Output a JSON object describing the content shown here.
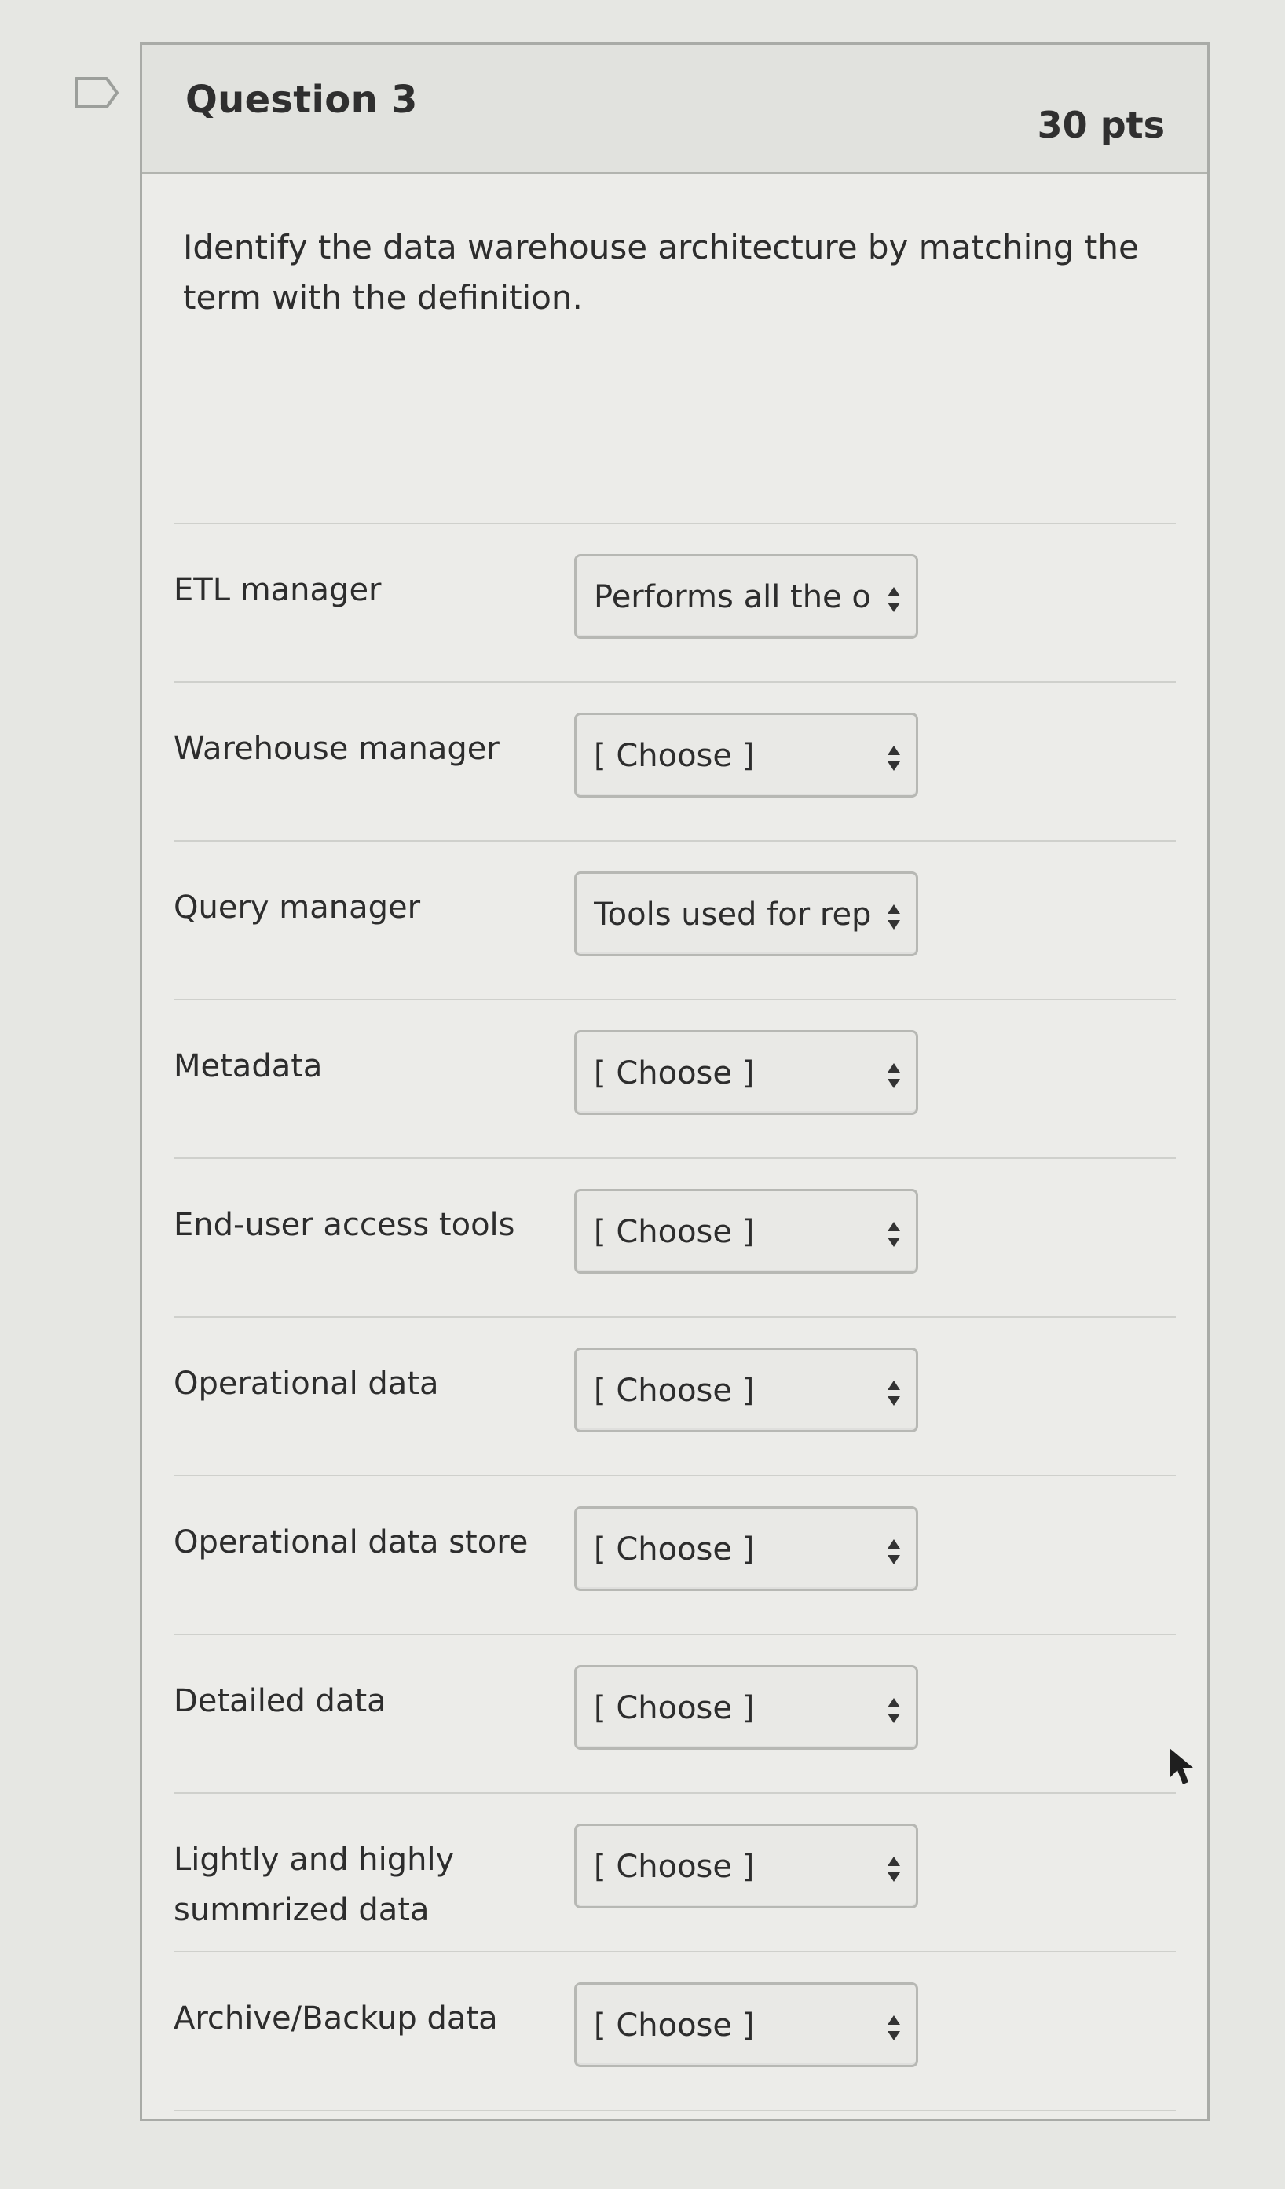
{
  "question": {
    "title": "Question 3",
    "points": "30 pts",
    "prompt": "Identify the data warehouse architecture by matching the term with the definition."
  },
  "matches": [
    {
      "term": "ETL manager",
      "selected": "Performs all the ope"
    },
    {
      "term": "Warehouse manager",
      "selected": "[ Choose ]"
    },
    {
      "term": "Query manager",
      "selected": "Tools used for repor"
    },
    {
      "term": "Metadata",
      "selected": "[ Choose ]"
    },
    {
      "term": "End-user access tools",
      "selected": "[ Choose ]"
    },
    {
      "term": "Operational data",
      "selected": "[ Choose ]"
    },
    {
      "term": "Operational data store",
      "selected": "[ Choose ]"
    },
    {
      "term": "Detailed data",
      "selected": "[ Choose ]"
    },
    {
      "term": "Lightly and highly summrized data",
      "selected": "[ Choose ]"
    },
    {
      "term": "Archive/Backup data",
      "selected": "[ Choose ]"
    }
  ],
  "icons": {
    "bookmark": "bookmark-outline-icon",
    "select_arrow": "up-down-arrow-icon",
    "cursor": "mouse-cursor-icon"
  },
  "colors": {
    "page_background": "#e6e7e3",
    "card_background": "#ecece9",
    "border": "#a9aba7",
    "text": "#2d2d2d"
  }
}
